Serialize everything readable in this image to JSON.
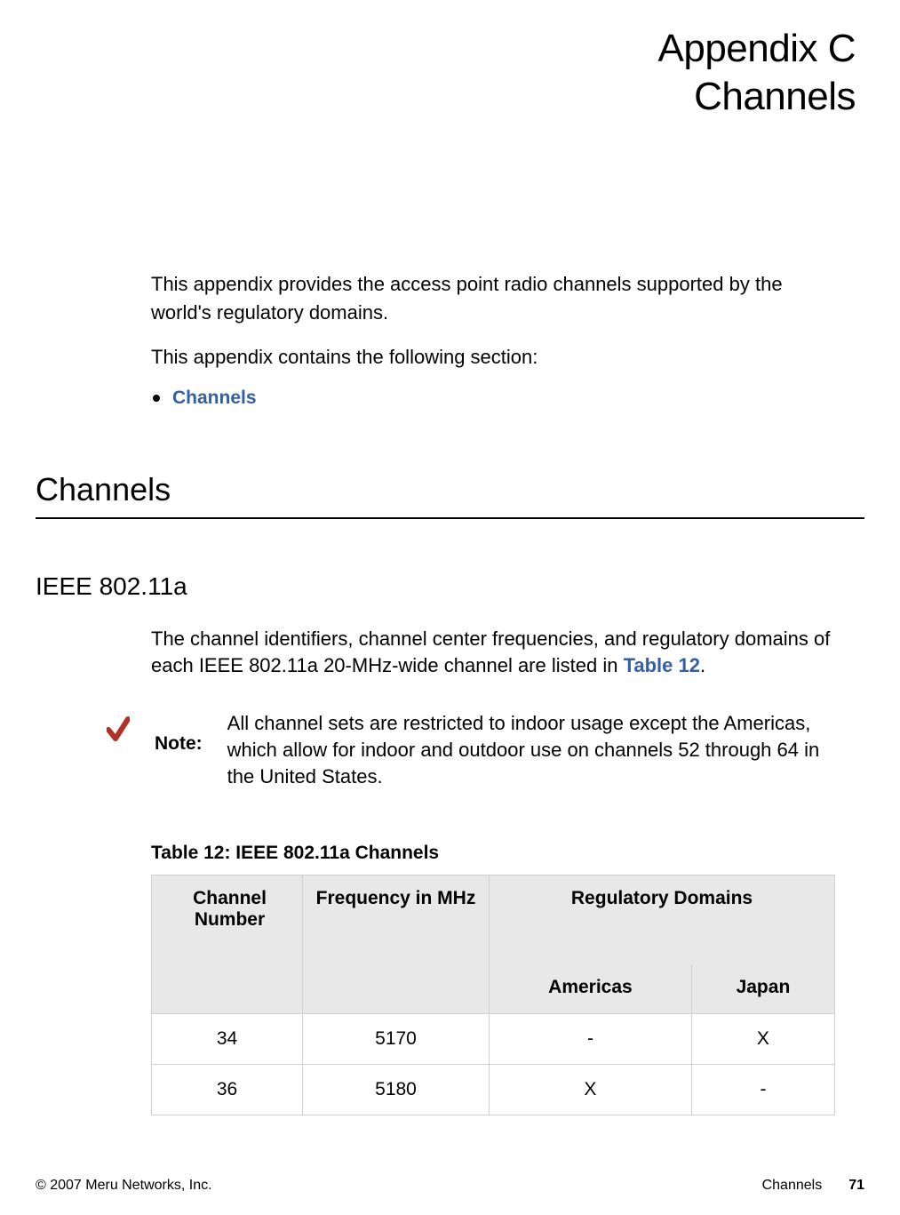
{
  "title": {
    "line1": "Appendix C",
    "line2": "Channels"
  },
  "intro": {
    "p1": "This appendix provides the access point radio channels supported by the world's regulatory domains.",
    "p2": "This appendix contains the following section:",
    "bullet_label": "Channels"
  },
  "section_heading": "Channels",
  "subheading": "IEEE 802.11a",
  "sub_intro": {
    "prefix": "The channel identifiers, channel center frequencies, and regulatory domains of each IEEE 802.11a 20-MHz-wide channel are listed in ",
    "link": "Table 12",
    "suffix": "."
  },
  "note": {
    "label": "Note:",
    "text": "All channel sets are restricted to indoor usage except the Americas, which allow for indoor and outdoor use on channels 52 through 64 in the United States."
  },
  "table": {
    "title": "Table 12: IEEE 802.11a Channels",
    "headers": {
      "channel": "Channel Number",
      "freq": "Frequency in MHz",
      "reg": "Regulatory Domains",
      "americas": "Americas",
      "japan": "Japan"
    }
  },
  "chart_data": {
    "type": "table",
    "title": "Table 12: IEEE 802.11a Channels",
    "columns": [
      "Channel Number",
      "Frequency in MHz",
      "Americas",
      "Japan"
    ],
    "rows": [
      {
        "channel": 34,
        "frequency": 5170,
        "americas": "-",
        "japan": "X"
      },
      {
        "channel": 36,
        "frequency": 5180,
        "americas": "X",
        "japan": "-"
      }
    ]
  },
  "footer": {
    "copyright": "© 2007 Meru Networks, Inc.",
    "section": "Channels",
    "page": "71"
  }
}
